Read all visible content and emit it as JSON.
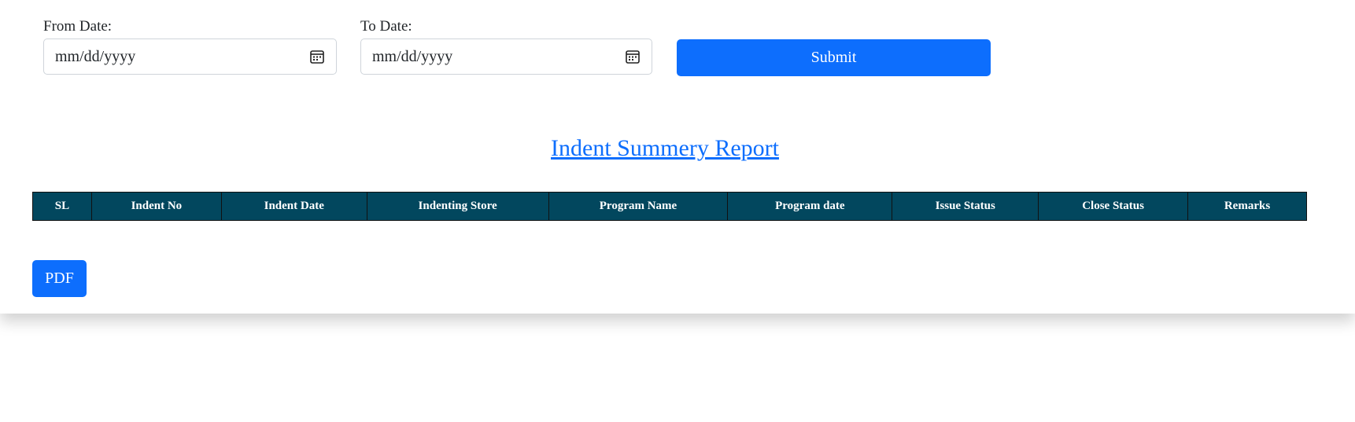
{
  "filters": {
    "from_label": "From Date:",
    "from_value": "mm/dd/yyyy",
    "to_label": "To Date:",
    "to_value": "mm/dd/yyyy",
    "submit_label": "Submit"
  },
  "report": {
    "title": "Indent Summery Report",
    "columns": [
      "SL",
      "Indent No",
      "Indent Date",
      "Indenting Store",
      "Program Name",
      "Program date",
      "Issue Status",
      "Close Status",
      "Remarks"
    ]
  },
  "actions": {
    "pdf_label": "PDF"
  },
  "colors": {
    "primary": "#0d6efd",
    "table_header": "#02475e"
  }
}
